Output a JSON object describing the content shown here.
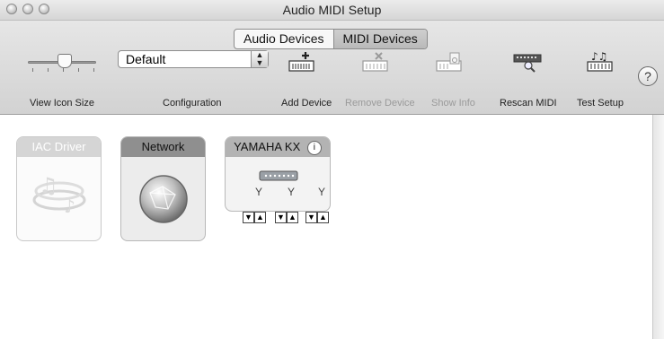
{
  "window": {
    "title": "Audio MIDI Setup"
  },
  "tabs": [
    {
      "label": "Audio Devices",
      "selected": false
    },
    {
      "label": "MIDI Devices",
      "selected": true
    }
  ],
  "toolbar": {
    "view_icon_size_label": "View Icon Size",
    "configuration_value": "Default",
    "configuration_label": "Configuration",
    "add_device_label": "Add Device",
    "remove_device_label": "Remove Device",
    "show_info_label": "Show Info",
    "rescan_midi_label": "Rescan MIDI",
    "test_setup_label": "Test Setup",
    "help_label": "?"
  },
  "devices": [
    {
      "name": "IAC Driver",
      "icon": "music-notes-icon",
      "enabled": false
    },
    {
      "name": "Network",
      "icon": "network-globe-icon",
      "enabled": true
    },
    {
      "name": "YAMAHA KX",
      "icon": "keyboard-icon",
      "enabled": true,
      "port_labels": [
        "Y",
        "Y",
        "Y"
      ]
    }
  ],
  "colors": {
    "toolbar_bg": "#d9d9d9",
    "device_header_disabled": "#c8c8c8",
    "device_header_active": "#8f8f8f"
  }
}
